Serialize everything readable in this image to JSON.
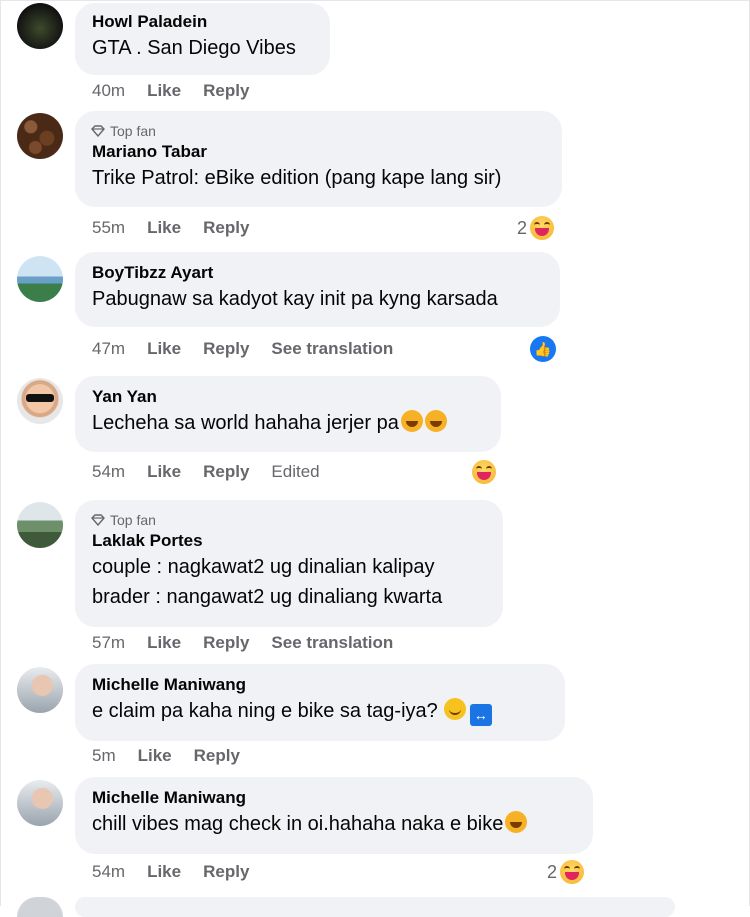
{
  "comments": [
    {
      "author": "Howl Paladein",
      "top_fan": false,
      "text": "GTA . San Diego Vibes",
      "time": "40m",
      "like": "Like",
      "reply": "Reply"
    },
    {
      "author": "Mariano Tabar",
      "top_fan": true,
      "top_fan_label": "Top fan",
      "text": "Trike Patrol: eBike edition (pang kape lang sir)",
      "time": "55m",
      "like": "Like",
      "reply": "Reply",
      "reaction_count": "2",
      "reaction_icon": "laughing-emoji"
    },
    {
      "author": "BoyTibzz Ayart",
      "top_fan": false,
      "text": "Pabugnaw sa kadyot kay init pa kyng karsada",
      "time": "47m",
      "like": "Like",
      "reply": "Reply",
      "translate": "See translation",
      "reaction_icon": "like-icon"
    },
    {
      "author": "Yan Yan",
      "top_fan": false,
      "text": "Lecheha sa world hahaha jerjer pa",
      "time": "54m",
      "like": "Like",
      "reply": "Reply",
      "edited": "Edited",
      "reaction_icon": "laughing-emoji"
    },
    {
      "author": "Laklak Portes",
      "top_fan": true,
      "top_fan_label": "Top fan",
      "text_line1": "couple : nagkawat2 ug dinalian kalipay",
      "text_line2": "brader : nangawat2 ug dinaliang kwarta",
      "time": "57m",
      "like": "Like",
      "reply": "Reply",
      "translate": "See translation"
    },
    {
      "author": "Michelle Maniwang",
      "top_fan": false,
      "text": "e claim pa kaha ning e bike sa tag-iya?",
      "time": "5m",
      "like": "Like",
      "reply": "Reply"
    },
    {
      "author": "Michelle Maniwang",
      "top_fan": false,
      "text": "chill vibes mag check in oi.hahaha naka e bike",
      "time": "54m",
      "like": "Like",
      "reply": "Reply",
      "reaction_count": "2",
      "reaction_icon": "laughing-emoji"
    }
  ],
  "colors": {
    "bubble": "#f0f2f5",
    "meta": "#65676b",
    "accent": "#1877f2"
  }
}
